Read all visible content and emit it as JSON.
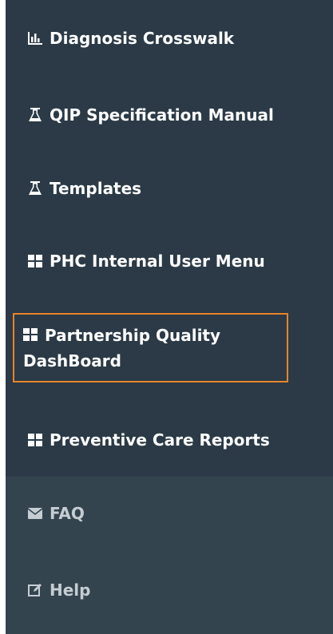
{
  "sidebar": {
    "items": [
      {
        "label": "Diagnosis Crosswalk",
        "icon": "bar-chart-icon"
      },
      {
        "label": "QIP Specification Manual",
        "icon": "flask-icon"
      },
      {
        "label": "Templates",
        "icon": "flask-icon"
      },
      {
        "label": "PHC Internal User Menu",
        "icon": "grid-icon"
      },
      {
        "label_line1": "Partnership Quality",
        "label_line2": "DashBoard",
        "icon": "grid-icon",
        "highlighted": true
      },
      {
        "label": "Preventive Care Reports",
        "icon": "grid-icon"
      },
      {
        "label": "FAQ",
        "icon": "envelope-icon"
      },
      {
        "label": "Help",
        "icon": "edit-icon"
      }
    ]
  },
  "colors": {
    "sidebar_bg": "#2b3a46",
    "sidebar_lower_bg": "#34444f",
    "highlight_border": "#e8832a",
    "text": "#ffffff",
    "muted_text": "#c5cdd3"
  }
}
